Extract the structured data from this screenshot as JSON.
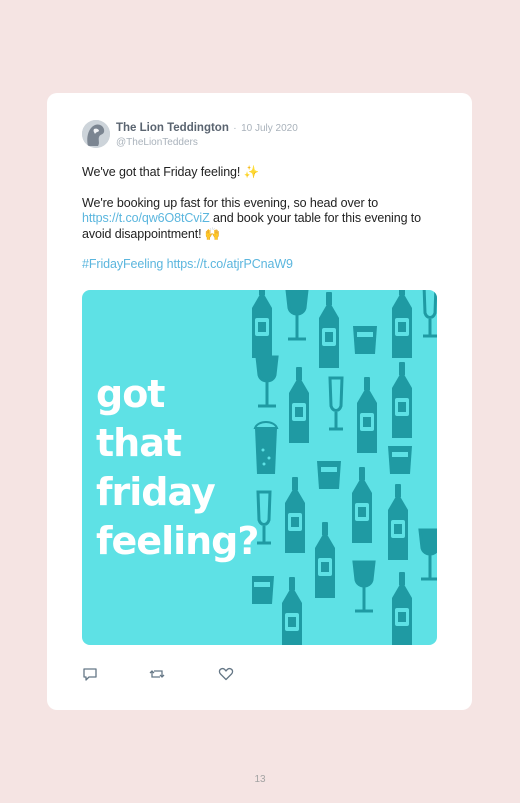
{
  "tweet": {
    "author_name": "The Lion Teddington",
    "separator": "·",
    "date": "10 July 2020",
    "handle": "@TheLionTedders",
    "line1": "We've got that Friday feeling! ✨",
    "line2_part1": "We're booking up fast for this evening, so head over to",
    "link1": "https://t.co/qw6O8tCviZ",
    "line2_part2": "and book your table for this evening to avoid disappointment! 🙌",
    "hashtag": "#FridayFeeling",
    "link2": "https://t.co/atjrPCnaW9"
  },
  "media": {
    "headline": [
      "got",
      "that",
      "friday",
      "feeling?"
    ],
    "background_color": "#5ee1e5",
    "pattern_color": "#1f9aa3",
    "pattern_icons": [
      "wine-glass-icon",
      "wine-bottle-icon",
      "beer-glass-icon",
      "champagne-flute-icon",
      "whisky-tumbler-icon",
      "spirit-bottle-icon"
    ]
  },
  "actions": [
    "reply-icon",
    "retweet-icon",
    "like-icon"
  ],
  "page_number": "13"
}
